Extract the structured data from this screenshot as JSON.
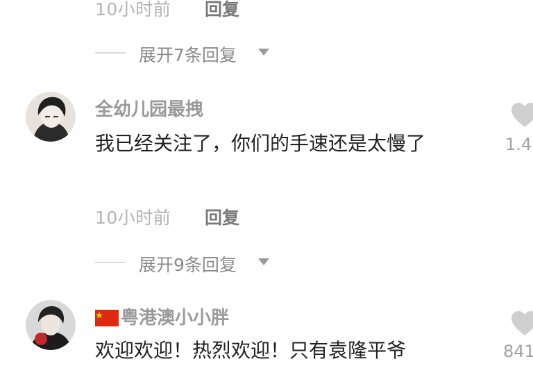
{
  "comments": [
    {
      "time": "10小时前",
      "reply": "回复",
      "expand": "展开7条回复"
    },
    {
      "username": "全幼儿园最拽",
      "text": "我已经关注了，你们的手速还是太慢了",
      "time": "10小时前",
      "reply": "回复",
      "expand": "展开9条回复",
      "likes": "1.4"
    },
    {
      "username": "粤港澳小小胖",
      "text": "欢迎欢迎！热烈欢迎！只有袁隆平爷",
      "likes": "841"
    }
  ],
  "colors": {
    "flag_red": "#de2910",
    "flag_yellow": "#ffde00",
    "heart": "#cfcfcf"
  }
}
